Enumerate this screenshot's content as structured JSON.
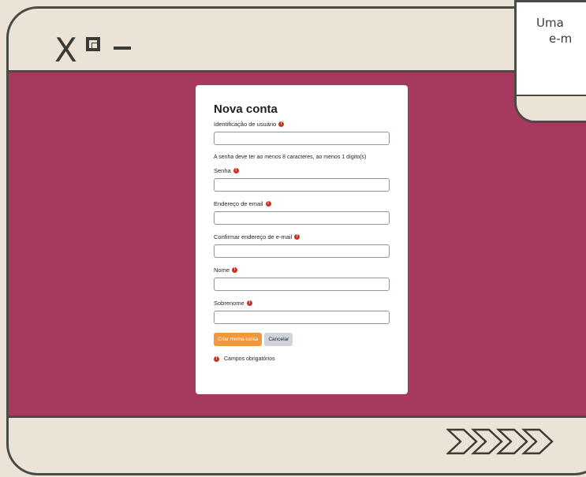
{
  "window": {
    "close_glyph": "X",
    "popup_lines": [
      "Uma",
      "e-m"
    ]
  },
  "form": {
    "title": "Nova conta",
    "password_hint": "A senha deve ter ao menos 8 caracteres, ao menos 1 dígito(s)",
    "fields": [
      {
        "label": "Identificação de usuário",
        "value": ""
      },
      {
        "label": "Senha",
        "value": ""
      },
      {
        "label": "Endereço de email",
        "value": ""
      },
      {
        "label": "Confirmar endereço de e-mail",
        "value": ""
      },
      {
        "label": "Nome",
        "value": ""
      },
      {
        "label": "Sobrenome",
        "value": ""
      }
    ],
    "submit_label": "Criar minha conta",
    "cancel_label": "Cancelar",
    "required_note": "Campos obrigatórios",
    "required_icon": "!"
  },
  "colors": {
    "background": "#ebe3d5",
    "stage": "#a6395e",
    "primary_button": "#f0983e",
    "secondary_button": "#ced4da",
    "required_icon": "#ca3120"
  }
}
